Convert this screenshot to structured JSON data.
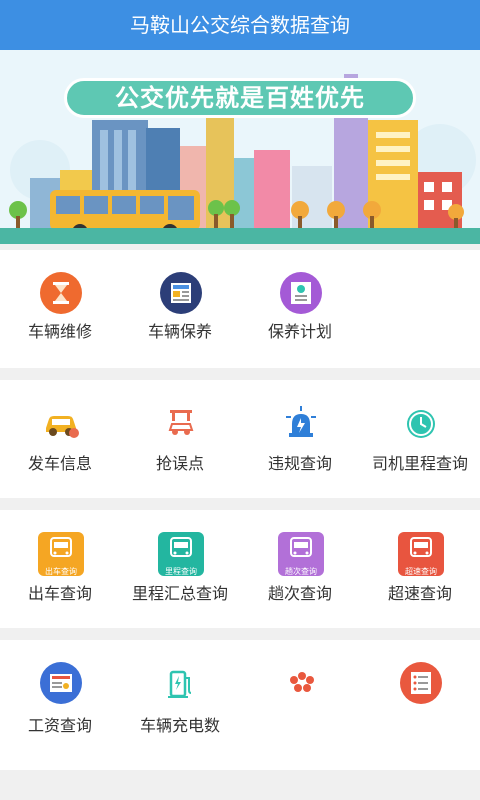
{
  "app": {
    "title": "马鞍山公交综合数据查询"
  },
  "banner": {
    "slogan": "公交优先就是百姓优先"
  },
  "sections": [
    {
      "items": [
        {
          "label": "车辆维修",
          "icon": "hourglass-icon",
          "color": "#ef6a2f"
        },
        {
          "label": "车辆保养",
          "icon": "news-icon",
          "color": "#2c3e78"
        },
        {
          "label": "保养计划",
          "icon": "person-document-icon",
          "color": "#a45ad6"
        }
      ]
    },
    {
      "items": [
        {
          "label": "发车信息",
          "icon": "car-icon",
          "color": "#f2b122"
        },
        {
          "label": "抢误点",
          "icon": "car-lift-icon",
          "color": "#e96b4f"
        },
        {
          "label": "违规查询",
          "icon": "siren-icon",
          "color": "#2f7fd8"
        },
        {
          "label": "司机里程查询",
          "icon": "clock-icon",
          "color": "#2ec4b0"
        }
      ]
    },
    {
      "items": [
        {
          "label": "出车查询",
          "icon": "bus-card-icon",
          "color": "#f5a623",
          "caption": "出车查询"
        },
        {
          "label": "里程汇总查询",
          "icon": "bus-card-icon",
          "color": "#23b6a0",
          "caption": "里程查询"
        },
        {
          "label": "趟次查询",
          "icon": "bus-card-icon",
          "color": "#b270d8",
          "caption": "趟次查询"
        },
        {
          "label": "超速查询",
          "icon": "bus-card-icon",
          "color": "#e8553f",
          "caption": "超速查询"
        }
      ]
    },
    {
      "items": [
        {
          "label": "工资查询",
          "icon": "wage-card-icon",
          "color": "#3b6fd6"
        },
        {
          "label": "车辆充电数",
          "icon": "charging-station-icon",
          "color": "#2ec4b0"
        },
        {
          "label": "",
          "icon": "dots-cluster-icon",
          "color": "#e9583e"
        },
        {
          "label": "",
          "icon": "list-card-icon",
          "color": "#e9583e"
        }
      ]
    }
  ]
}
